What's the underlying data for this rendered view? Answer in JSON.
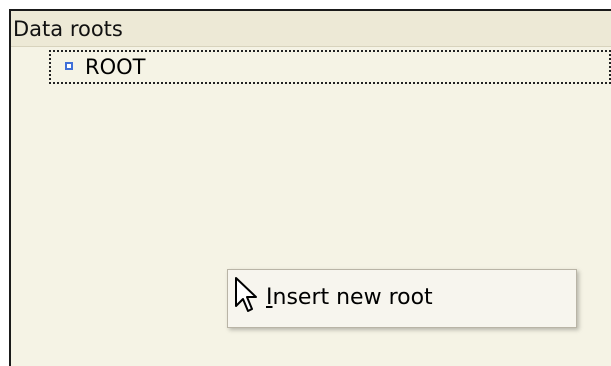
{
  "panel": {
    "title": "Data roots"
  },
  "tree": {
    "items": [
      {
        "label": "ROOT",
        "icon": "tree-node-icon"
      }
    ]
  },
  "context_menu": {
    "items": [
      {
        "label": "Insert new root",
        "accelerator": "I"
      }
    ]
  },
  "cursor": {
    "icon": "mouse-pointer-icon"
  },
  "colors": {
    "panel_background": "#f5f3e5",
    "header_background": "#ede9d6",
    "menu_background": "#f7f5ee",
    "node_icon_border": "#3f6fd8"
  }
}
